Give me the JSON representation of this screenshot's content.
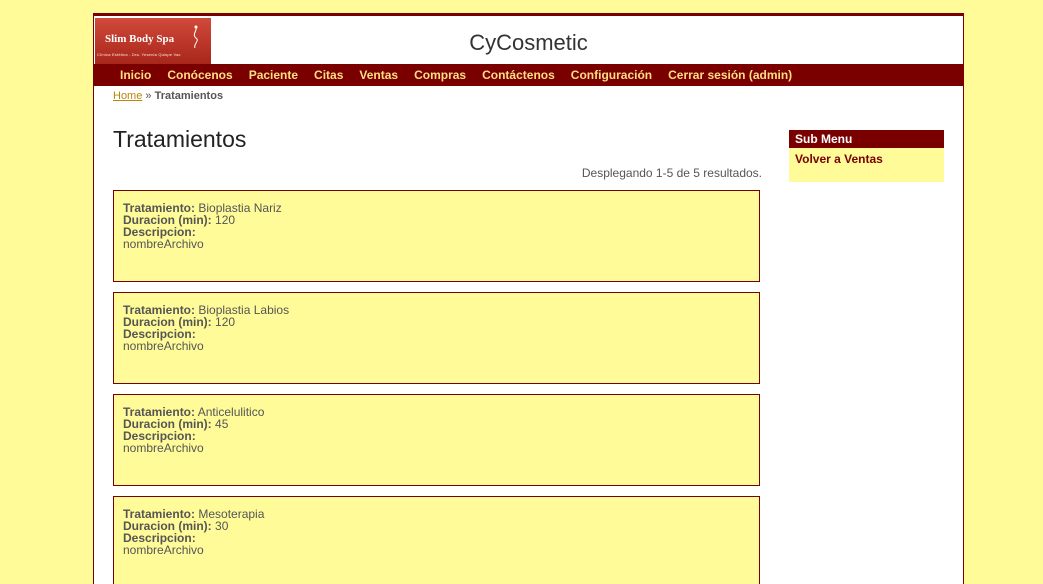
{
  "logo": {
    "brand": "Slim Body Spa",
    "tagline": "Clínica Estética - Dra. Yesenia Quispe Vac"
  },
  "site_title": "CyCosmetic",
  "nav": [
    {
      "label": "Inicio"
    },
    {
      "label": "Conócenos"
    },
    {
      "label": "Paciente"
    },
    {
      "label": "Citas"
    },
    {
      "label": "Ventas"
    },
    {
      "label": "Compras"
    },
    {
      "label": "Contáctenos"
    },
    {
      "label": "Configuración"
    },
    {
      "label": "Cerrar sesión (admin)"
    }
  ],
  "breadcrumb": {
    "home": "Home",
    "separator": "»",
    "current": "Tratamientos"
  },
  "page_title": "Tratamientos",
  "summary": "Desplegando 1-5 de 5 resultados.",
  "labels": {
    "tratamiento": "Tratamiento:",
    "duracion": "Duracion (min):",
    "descripcion": "Descripcion:"
  },
  "items": [
    {
      "tratamiento": "Bioplastia Nariz",
      "duracion": "120",
      "archivo": "nombreArchivo"
    },
    {
      "tratamiento": "Bioplastia Labios",
      "duracion": "120",
      "archivo": "nombreArchivo"
    },
    {
      "tratamiento": "Anticelulitico",
      "duracion": "45",
      "archivo": "nombreArchivo"
    },
    {
      "tratamiento": "Mesoterapia",
      "duracion": "30",
      "archivo": "nombreArchivo"
    }
  ],
  "sidebar": {
    "title": "Sub Menu",
    "links": [
      {
        "label": "Volver a Ventas"
      }
    ]
  },
  "colors": {
    "background": "#fffb99",
    "accent": "#7a0000",
    "nav_text": "#ffdf80"
  }
}
